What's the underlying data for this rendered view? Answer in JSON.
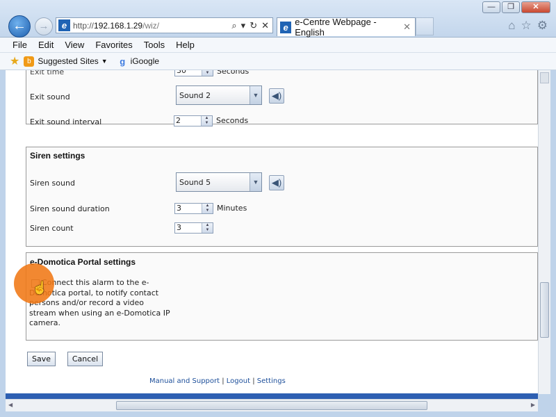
{
  "browser": {
    "window_controls": {
      "minimize": "—",
      "maximize": "❐",
      "close": "✕"
    },
    "address": {
      "scheme": "http://",
      "host": "192.168.1.29",
      "path": "/wiz/"
    },
    "tab": {
      "title": "e-Centre Webpage - English",
      "close": "✕"
    },
    "menu": [
      "File",
      "Edit",
      "View",
      "Favorites",
      "Tools",
      "Help"
    ],
    "favorites": [
      {
        "label": "Suggested Sites",
        "icon": "suggested-sites-icon",
        "dropdown": true
      },
      {
        "label": "iGoogle",
        "icon": "google-icon",
        "dropdown": false
      }
    ]
  },
  "page": {
    "exit": {
      "exit_time_partial": "Exit time",
      "exit_time_unit": "Seconds",
      "exit_sound_label": "Exit sound",
      "exit_sound_value": "Sound 2",
      "exit_interval_label": "Exit sound interval",
      "exit_interval_value": "2",
      "exit_interval_unit": "Seconds"
    },
    "siren": {
      "title": "Siren settings",
      "sound_label": "Siren sound",
      "sound_value": "Sound 5",
      "duration_label": "Siren sound duration",
      "duration_value": "3",
      "duration_unit": "Minutes",
      "count_label": "Siren count",
      "count_value": "3"
    },
    "portal": {
      "title": "e-Domotica Portal settings",
      "checkbox_text": "Connect this alarm to the e-Domotica portal, to notify contact persons and/or record a video stream when using an e-Domotica IP camera.",
      "checked": false
    },
    "buttons": {
      "save": "Save",
      "cancel": "Cancel"
    },
    "footer": {
      "manual": "Manual and Support",
      "sep1": " | ",
      "logout": "Logout",
      "sep2": " | ",
      "settings": "Settings"
    }
  },
  "colors": {
    "accent_blue": "#2d5fb2",
    "click_highlight": "#f07814",
    "link": "#1d4f9a"
  }
}
